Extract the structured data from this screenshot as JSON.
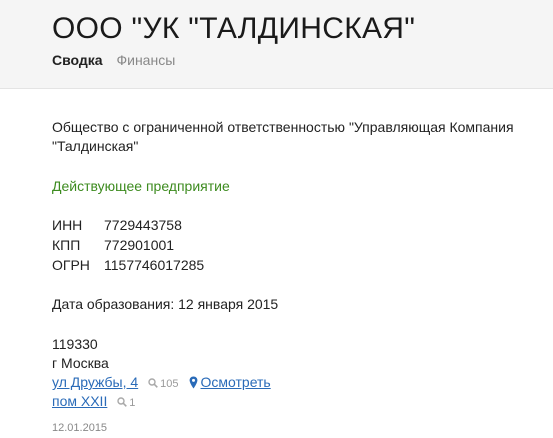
{
  "header": {
    "title": "ООО \"УК \"ТАЛДИНСКАЯ\"",
    "tabs": [
      {
        "label": "Сводка",
        "active": true
      },
      {
        "label": "Финансы",
        "active": false
      }
    ]
  },
  "company": {
    "full_name": "Общество с ограниченной ответственностью \"Управляющая Компания \"Талдинская\"",
    "status": "Действующее предприятие",
    "codes": [
      {
        "label": "ИНН",
        "value": "7729443758"
      },
      {
        "label": "КПП",
        "value": "772901001"
      },
      {
        "label": "ОГРН",
        "value": "1157746017285"
      }
    ],
    "founded": "Дата образования: 12 января 2015"
  },
  "address": {
    "postal_code": "119330",
    "city": "г Москва",
    "street_link": "ул Дружбы, 4",
    "street_count": "105",
    "view_link": "Осмотреть",
    "room_link": "пом XXII",
    "room_count": "1"
  },
  "update_date": "12.01.2015",
  "colors": {
    "status": "#3d8b1f",
    "link": "#2a6bb8",
    "header_bg": "#f5f5f5"
  },
  "icons": [
    "search-icon",
    "map-pin-icon"
  ]
}
